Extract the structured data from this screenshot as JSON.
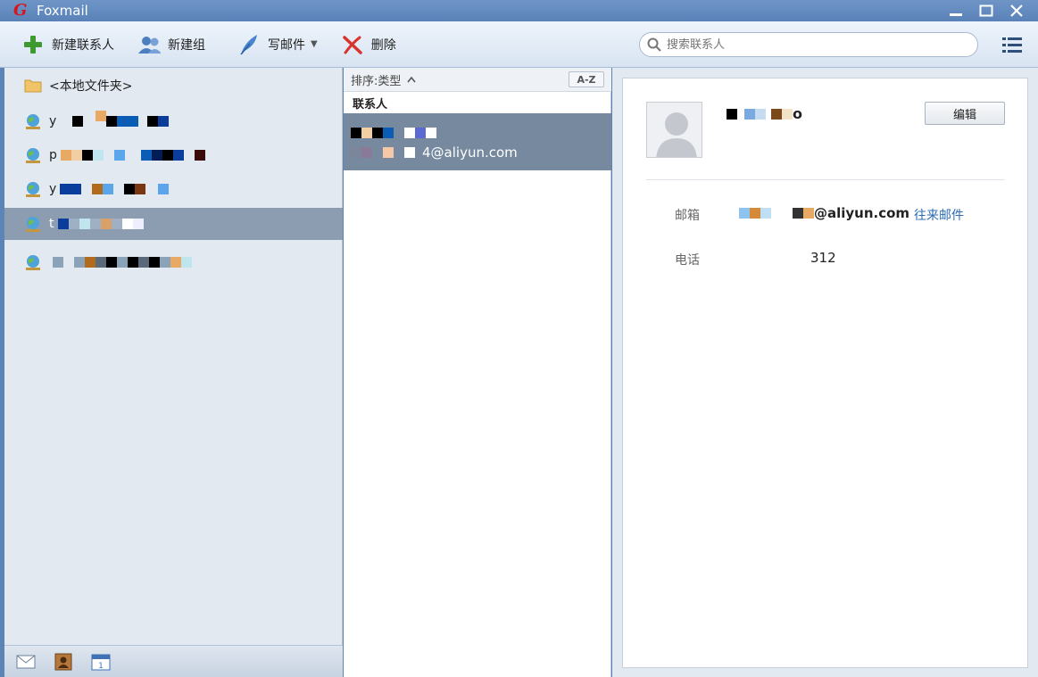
{
  "window": {
    "title": "Foxmail",
    "logo_letter": "G"
  },
  "toolbar": {
    "new_contact": "新建联系人",
    "new_group": "新建组",
    "compose": "写邮件",
    "delete": "删除",
    "search_placeholder": "搜索联系人"
  },
  "folders": {
    "local": "<本地文件夹>",
    "accounts": [
      {
        "prefix": "y",
        "selected": false
      },
      {
        "prefix": "p",
        "selected": false
      },
      {
        "prefix": "y",
        "selected": false
      },
      {
        "prefix": "t",
        "selected": true
      },
      {
        "prefix": "",
        "selected": false
      }
    ]
  },
  "list": {
    "sort_label": "排序:类型",
    "az_label": "A-Z",
    "group_header": "联系人",
    "contact_email_suffix": "4@aliyun.com"
  },
  "detail": {
    "name_suffix": "o",
    "edit_label": "编辑",
    "email_label": "邮箱",
    "email_suffix": "@aliyun.com",
    "email_link": "往来邮件",
    "phone_label": "电话",
    "phone_suffix": "312"
  },
  "colors": {
    "titlebar": "#5a82b8",
    "selected_row": "#8d9db1",
    "selected_contact": "#76899f",
    "link": "#2c6cb4"
  }
}
